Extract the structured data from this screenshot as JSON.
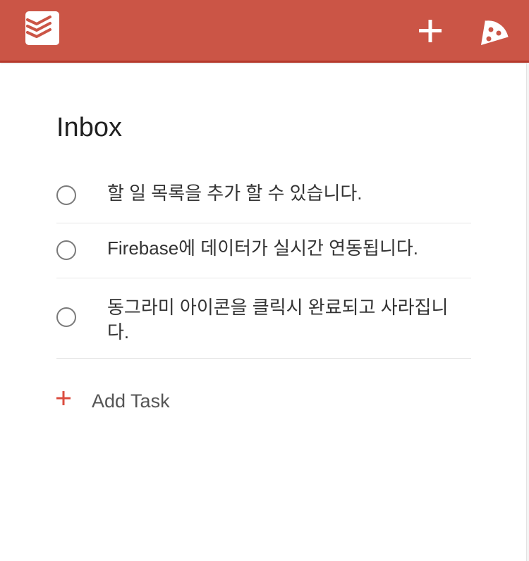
{
  "header": {
    "logo_icon": "todoist-logo-icon",
    "add_icon": "plus-icon",
    "karma_icon": "pizza-slice-icon",
    "brand_color": "#cb5546"
  },
  "main": {
    "title": "Inbox",
    "tasks": [
      {
        "text": "할 일 목록을 추가 할 수 있습니다."
      },
      {
        "text": "Firebase에 데이터가 실시간 연동됩니다."
      },
      {
        "text": "동그라미 아이콘을 클릭시 완료되고 사라집니다."
      }
    ],
    "add_task_label": "Add Task",
    "add_task_icon": "plus-icon",
    "accent_color": "#db4c3f"
  }
}
